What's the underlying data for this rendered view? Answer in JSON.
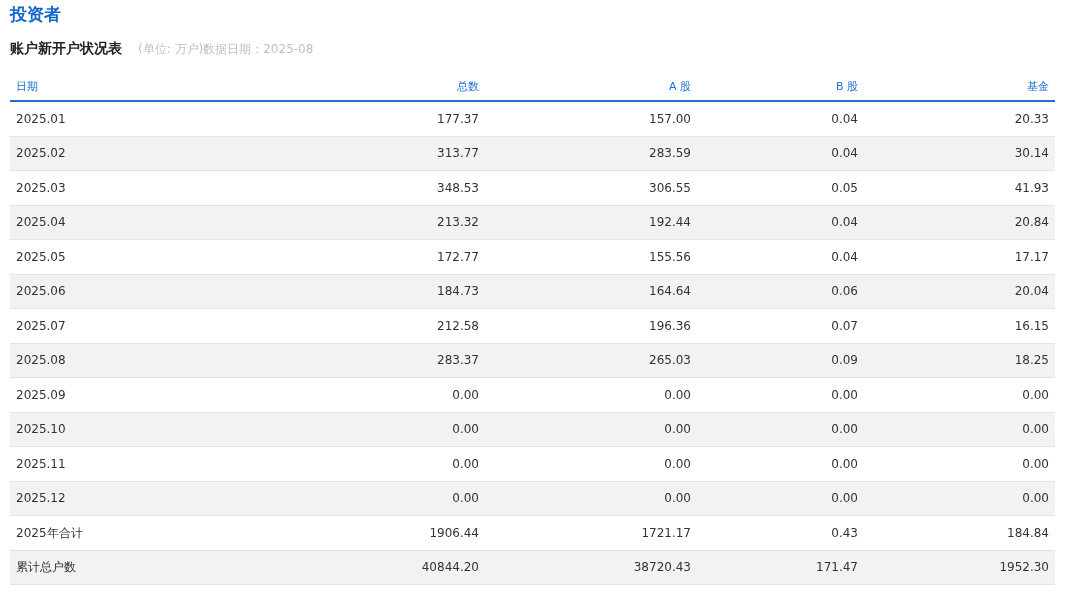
{
  "page_title": "投资者",
  "table_title": "账户新开户状况表",
  "table_note": "(单位: 万户)数据日期：2025-08",
  "table": {
    "columns": [
      "日期",
      "总数",
      "A 股",
      "B 股",
      "基金"
    ],
    "rows": [
      [
        "2025.01",
        "177.37",
        "157.00",
        "0.04",
        "20.33"
      ],
      [
        "2025.02",
        "313.77",
        "283.59",
        "0.04",
        "30.14"
      ],
      [
        "2025.03",
        "348.53",
        "306.55",
        "0.05",
        "41.93"
      ],
      [
        "2025.04",
        "213.32",
        "192.44",
        "0.04",
        "20.84"
      ],
      [
        "2025.05",
        "172.77",
        "155.56",
        "0.04",
        "17.17"
      ],
      [
        "2025.06",
        "184.73",
        "164.64",
        "0.06",
        "20.04"
      ],
      [
        "2025.07",
        "212.58",
        "196.36",
        "0.07",
        "16.15"
      ],
      [
        "2025.08",
        "283.37",
        "265.03",
        "0.09",
        "18.25"
      ],
      [
        "2025.09",
        "0.00",
        "0.00",
        "0.00",
        "0.00"
      ],
      [
        "2025.10",
        "0.00",
        "0.00",
        "0.00",
        "0.00"
      ],
      [
        "2025.11",
        "0.00",
        "0.00",
        "0.00",
        "0.00"
      ],
      [
        "2025.12",
        "0.00",
        "0.00",
        "0.00",
        "0.00"
      ],
      [
        "2025年合计",
        "1906.44",
        "1721.17",
        "0.43",
        "184.84"
      ],
      [
        "累计总户数",
        "40844.20",
        "38720.43",
        "171.47",
        "1952.30"
      ]
    ]
  }
}
